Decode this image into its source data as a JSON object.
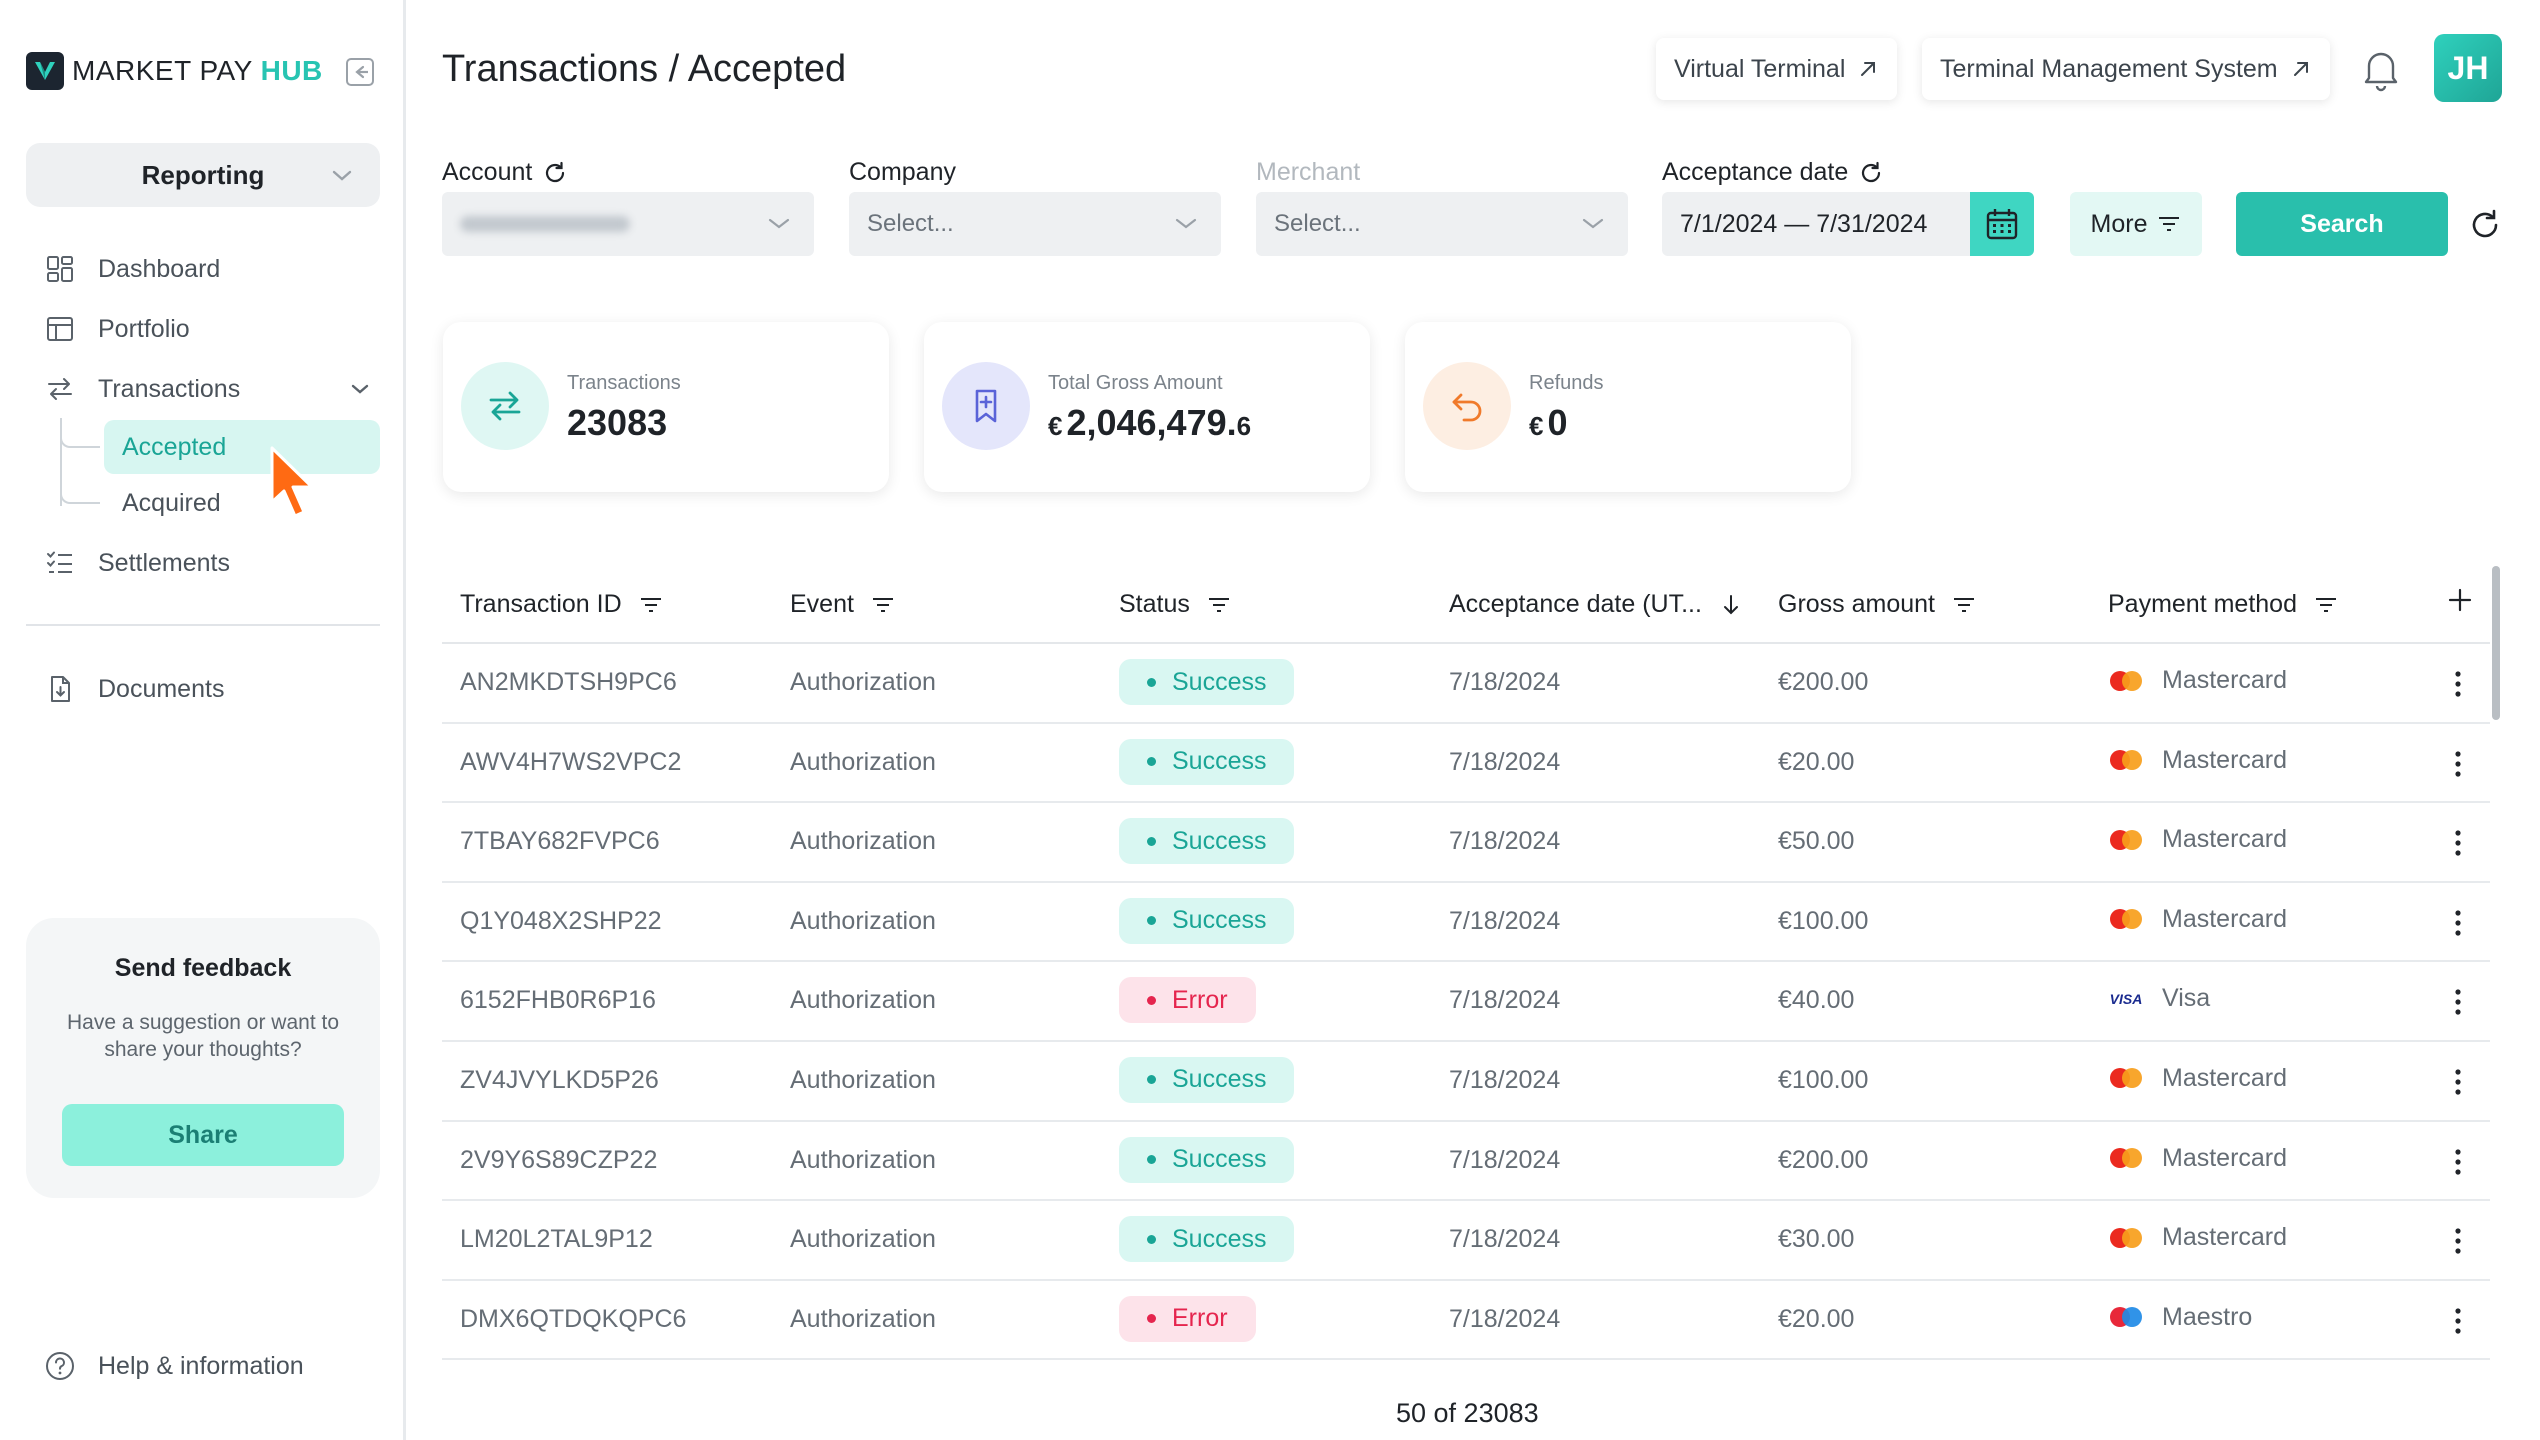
{
  "brand": {
    "name_part1": "MARKET PAY",
    "name_part2": "HUB",
    "accent_color": "#27c4b2"
  },
  "sidebar": {
    "section_select": "Reporting",
    "items": [
      {
        "label": "Dashboard",
        "icon": "dashboard-icon"
      },
      {
        "label": "Portfolio",
        "icon": "portfolio-icon"
      },
      {
        "label": "Transactions",
        "icon": "transactions-icon",
        "expanded": true
      },
      {
        "label": "Settlements",
        "icon": "settlements-icon"
      },
      {
        "label": "Documents",
        "icon": "documents-icon"
      }
    ],
    "sub_items": [
      {
        "label": "Accepted",
        "active": true
      },
      {
        "label": "Acquired",
        "active": false
      }
    ],
    "feedback": {
      "title": "Send feedback",
      "description": "Have a suggestion or want to share your thoughts?",
      "button": "Share"
    },
    "help": "Help & information"
  },
  "header": {
    "title": "Transactions / Accepted",
    "virtual_terminal": "Virtual Terminal",
    "terminal_mgmt": "Terminal Management System",
    "avatar_initials": "JH"
  },
  "filters": {
    "account_label": "Account",
    "company_label": "Company",
    "company_placeholder": "Select...",
    "merchant_label": "Merchant",
    "merchant_placeholder": "Select...",
    "date_label": "Acceptance date",
    "date_value": "7/1/2024 — 7/31/2024",
    "more": "More",
    "search": "Search"
  },
  "stats": [
    {
      "label": "Transactions",
      "value": "23083",
      "currency": "",
      "decimal": ""
    },
    {
      "label": "Total Gross Amount",
      "value": "2,046,479.",
      "currency": "€",
      "decimal": "6"
    },
    {
      "label": "Refunds",
      "value": "0",
      "currency": "€",
      "decimal": ""
    }
  ],
  "table": {
    "columns": [
      "Transaction ID",
      "Event",
      "Status",
      "Acceptance date (UT...",
      "Gross amount",
      "Payment method"
    ],
    "rows": [
      {
        "id": "AN2MKDTSH9PC6",
        "event": "Authorization",
        "status": "Success",
        "date": "7/18/2024",
        "amount": "€200.00",
        "method": "Mastercard"
      },
      {
        "id": "AWV4H7WS2VPC2",
        "event": "Authorization",
        "status": "Success",
        "date": "7/18/2024",
        "amount": "€20.00",
        "method": "Mastercard"
      },
      {
        "id": "7TBAY682FVPC6",
        "event": "Authorization",
        "status": "Success",
        "date": "7/18/2024",
        "amount": "€50.00",
        "method": "Mastercard"
      },
      {
        "id": "Q1Y048X2SHP22",
        "event": "Authorization",
        "status": "Success",
        "date": "7/18/2024",
        "amount": "€100.00",
        "method": "Mastercard"
      },
      {
        "id": "6152FHB0R6P16",
        "event": "Authorization",
        "status": "Error",
        "date": "7/18/2024",
        "amount": "€40.00",
        "method": "Visa"
      },
      {
        "id": "ZV4JVYLKD5P26",
        "event": "Authorization",
        "status": "Success",
        "date": "7/18/2024",
        "amount": "€100.00",
        "method": "Mastercard"
      },
      {
        "id": "2V9Y6S89CZP22",
        "event": "Authorization",
        "status": "Success",
        "date": "7/18/2024",
        "amount": "€200.00",
        "method": "Mastercard"
      },
      {
        "id": "LM20L2TAL9P12",
        "event": "Authorization",
        "status": "Success",
        "date": "7/18/2024",
        "amount": "€30.00",
        "method": "Mastercard"
      },
      {
        "id": "DMX6QTDQKQPC6",
        "event": "Authorization",
        "status": "Error",
        "date": "7/18/2024",
        "amount": "€20.00",
        "method": "Maestro"
      }
    ],
    "pager": "50 of 23083"
  }
}
